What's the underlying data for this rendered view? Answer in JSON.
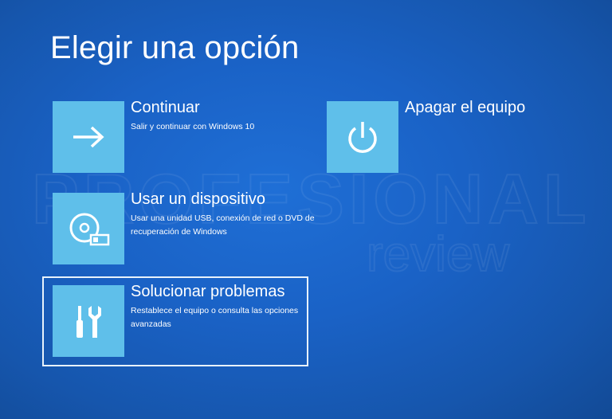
{
  "page": {
    "title": "Elegir una opción"
  },
  "options": [
    {
      "title": "Continuar",
      "description": "Salir y continuar con Windows 10",
      "icon": "arrow-right-icon"
    },
    {
      "title": "Usar un dispositivo",
      "description": "Usar una unidad USB, conexión de red o DVD de recuperación de Windows",
      "icon": "disc-usb-icon"
    },
    {
      "title": "Solucionar problemas",
      "description": "Restablece el equipo o consulta las opciones avanzadas",
      "icon": "tools-icon",
      "selected": true
    },
    {
      "title": "Apagar el equipo",
      "icon": "power-icon"
    }
  ],
  "watermark": {
    "line1": "PROFESIONAL",
    "line2": "review"
  },
  "colors": {
    "background": "#1a62c6",
    "tile": "#5fbfea",
    "text": "#ffffff",
    "selection_border": "#e8f2fb"
  }
}
